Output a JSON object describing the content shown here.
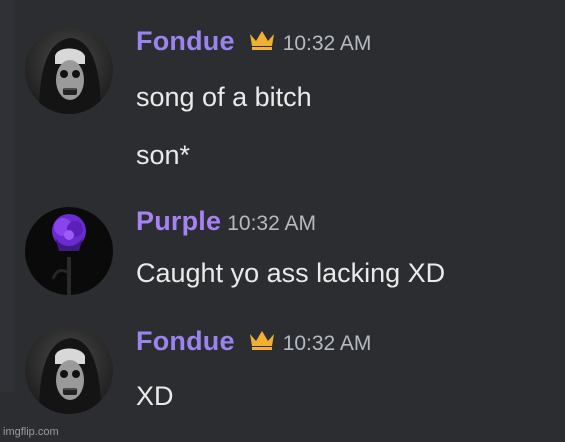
{
  "messages": [
    {
      "username": "Fondue",
      "username_color": "#9b84ee",
      "has_crown": true,
      "timestamp": "10:32 AM",
      "avatar": "nun-avatar",
      "lines": [
        "song of a bitch",
        "son*"
      ]
    },
    {
      "username": "Purple",
      "username_color": "#a682f5",
      "has_crown": false,
      "timestamp": "10:32 AM",
      "avatar": "purple-rose-avatar",
      "lines": [
        "Caught yo ass lacking XD"
      ]
    },
    {
      "username": "Fondue",
      "username_color": "#9b84ee",
      "has_crown": true,
      "timestamp": "10:32 AM",
      "avatar": "nun-avatar",
      "lines": [
        "XD"
      ]
    }
  ],
  "crown_color": "#f0b132",
  "watermark": "imgflip.com"
}
